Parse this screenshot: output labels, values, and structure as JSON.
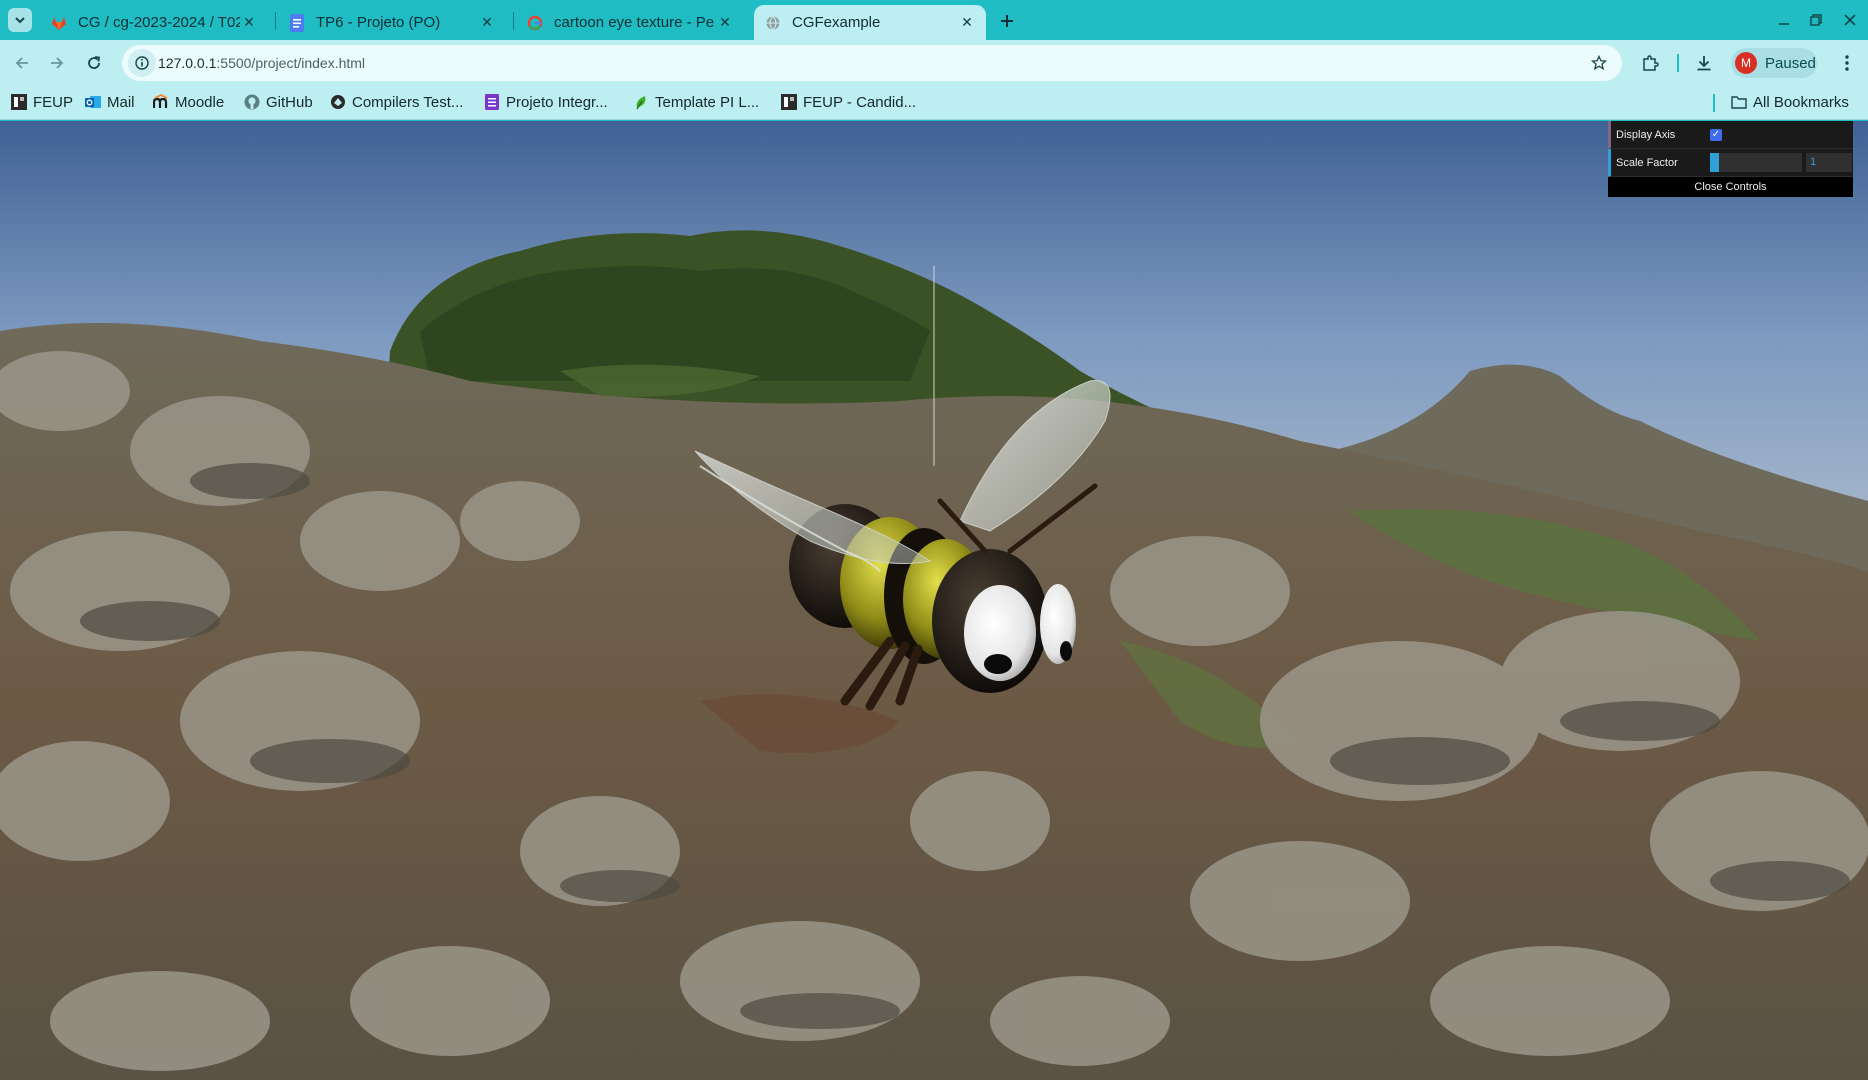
{
  "tabs": [
    {
      "title": "CG / cg-2023-2024 / T02",
      "icon": "gitlab-icon",
      "active": false
    },
    {
      "title": "TP6 - Projeto (PO)",
      "icon": "google-docs-icon",
      "active": false
    },
    {
      "title": "cartoon eye texture - Pe",
      "icon": "google-icon",
      "active": false
    },
    {
      "title": "CGFexample",
      "icon": "globe-icon",
      "active": true
    }
  ],
  "toolbar": {
    "url_host": "127.0.0.1",
    "url_path": ":5500/project/index.html",
    "profile_initial": "M",
    "profile_label": "Paused"
  },
  "bookmarks": [
    {
      "label": "FEUP",
      "icon": "feup-icon"
    },
    {
      "label": "Mail",
      "icon": "outlook-icon"
    },
    {
      "label": "Moodle",
      "icon": "moodle-icon"
    },
    {
      "label": "GitHub",
      "icon": "github-icon"
    },
    {
      "label": "Compilers Test...",
      "icon": "compilers-icon"
    },
    {
      "label": "Projeto Integr...",
      "icon": "list-icon"
    },
    {
      "label": "Template PI L...",
      "icon": "leaf-icon"
    },
    {
      "label": "FEUP - Candid...",
      "icon": "feup-icon"
    }
  ],
  "all_bookmarks_label": "All Bookmarks",
  "gui": {
    "display_axis_label": "Display Axis",
    "display_axis_checked": true,
    "scale_factor_label": "Scale Factor",
    "scale_factor_value": "1",
    "scale_factor_fraction": 0.1,
    "close_label": "Close Controls"
  }
}
